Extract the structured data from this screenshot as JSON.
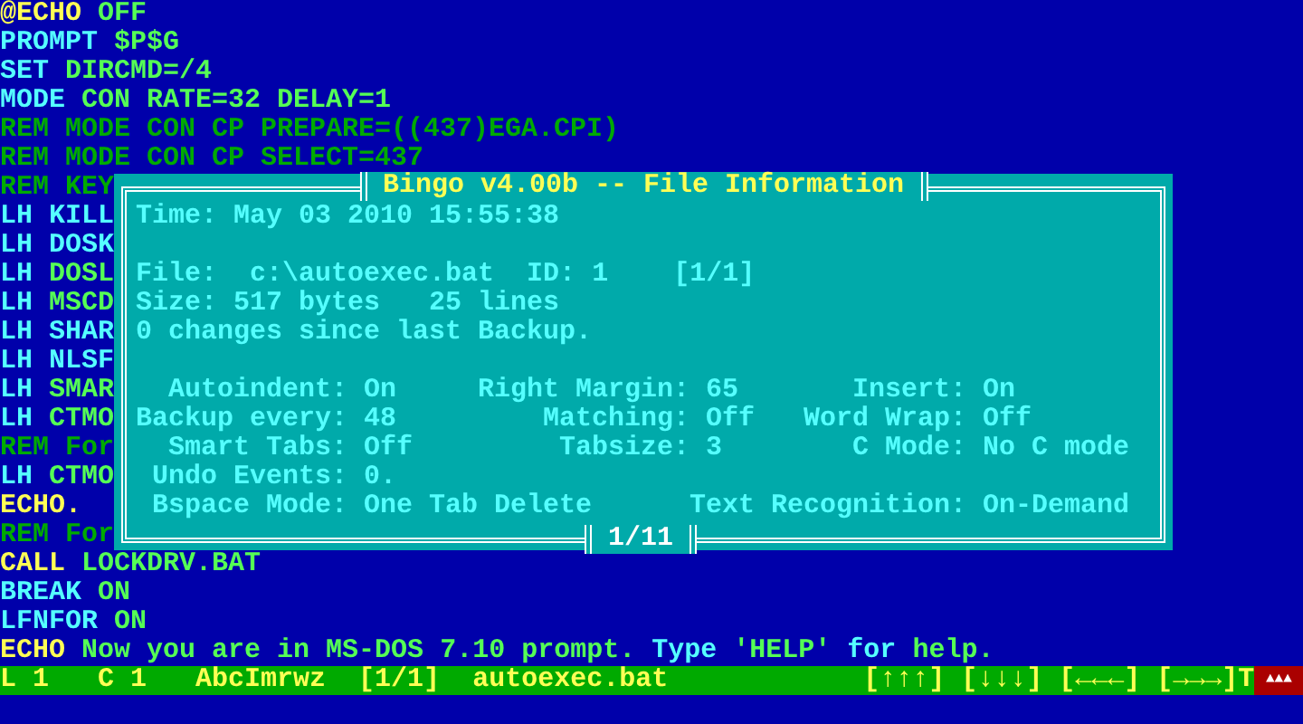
{
  "editor": {
    "lines": [
      [
        {
          "text": "@ECHO",
          "kind": "echo"
        },
        {
          "text": "OFF",
          "kind": "argument"
        }
      ],
      [
        {
          "text": "PROMPT",
          "kind": "command"
        },
        {
          "text": "$P$G",
          "kind": "argument"
        }
      ],
      [
        {
          "text": "SET",
          "kind": "command"
        },
        {
          "text": "DIRCMD=/4",
          "kind": "argument"
        }
      ],
      [
        {
          "text": "MODE",
          "kind": "command"
        },
        {
          "text": "CON RATE=32 DELAY=1",
          "kind": "argument"
        }
      ],
      [
        {
          "text": "REM MODE CON CP PREPARE=((437)EGA.CPI)",
          "kind": "comment"
        }
      ],
      [
        {
          "text": "REM MODE CON CP SELECT=437",
          "kind": "comment"
        }
      ],
      [
        {
          "text": "REM KEY",
          "kind": "comment"
        }
      ],
      [
        {
          "text": "LH",
          "kind": "command"
        },
        {
          "text": "KILL",
          "kind": "command"
        }
      ],
      [
        {
          "text": "LH",
          "kind": "command"
        },
        {
          "text": "DOSK",
          "kind": "command"
        }
      ],
      [
        {
          "text": "LH",
          "kind": "command"
        },
        {
          "text": "DOSL",
          "kind": "argument"
        }
      ],
      [
        {
          "text": "LH",
          "kind": "command"
        },
        {
          "text": "MSCD",
          "kind": "argument"
        }
      ],
      [
        {
          "text": "LH",
          "kind": "command"
        },
        {
          "text": "SHAR",
          "kind": "command"
        }
      ],
      [
        {
          "text": "LH",
          "kind": "command"
        },
        {
          "text": "NLSF",
          "kind": "command"
        }
      ],
      [
        {
          "text": "LH",
          "kind": "command"
        },
        {
          "text": "SMAR",
          "kind": "argument"
        }
      ],
      [
        {
          "text": "LH",
          "kind": "command"
        },
        {
          "text": "CTMO",
          "kind": "argument"
        }
      ],
      [
        {
          "text": "REM For",
          "kind": "comment"
        }
      ],
      [
        {
          "text": "LH",
          "kind": "command"
        },
        {
          "text": "CTMO",
          "kind": "argument"
        }
      ],
      [
        {
          "text": "ECHO.",
          "kind": "echo"
        }
      ],
      [
        {
          "text": "REM For",
          "kind": "comment"
        }
      ],
      [
        {
          "text": "CALL",
          "kind": "echo"
        },
        {
          "text": "LOCKDRV.BAT",
          "kind": "argument"
        }
      ],
      [
        {
          "text": "BREAK",
          "kind": "command"
        },
        {
          "text": "ON",
          "kind": "argument"
        }
      ],
      [
        {
          "text": "LFNFOR",
          "kind": "command"
        },
        {
          "text": "ON",
          "kind": "argument"
        }
      ],
      [
        {
          "text": "ECHO",
          "kind": "echo"
        },
        {
          "text": "Now you are in MS-DOS 7.10 prompt.",
          "kind": "argument"
        },
        {
          "text": "Type",
          "kind": "command"
        },
        {
          "text": "'HELP'",
          "kind": "argument"
        },
        {
          "text": "for",
          "kind": "command"
        },
        {
          "text": "help.",
          "kind": "argument"
        }
      ]
    ]
  },
  "dialog": {
    "title": "Bingo v4.00b -- File Information",
    "time": "Time: May 03 2010 15:55:38",
    "file_label": "File:",
    "file_path": "c:\\autoexec.bat",
    "id_label": "ID:",
    "id": "1",
    "position": "[1/1]",
    "size": "Size: 517 bytes",
    "lines": "25 lines",
    "changes": "0 changes since last Backup.",
    "settings": [
      [
        {
          "label": "Autoindent:",
          "value": "On"
        },
        {
          "label": "Right Margin:",
          "value": "65"
        },
        {
          "label": "Insert:",
          "value": "On"
        }
      ],
      [
        {
          "label": "Backup every:",
          "value": "48"
        },
        {
          "label": "Matching:",
          "value": "Off"
        },
        {
          "label": "Word Wrap:",
          "value": "Off"
        }
      ],
      [
        {
          "label": "Smart Tabs:",
          "value": "Off"
        },
        {
          "label": "Tabsize:",
          "value": "3"
        },
        {
          "label": "C Mode:",
          "value": "No C mode"
        }
      ]
    ],
    "undo": {
      "label": "Undo Events:",
      "value": "0."
    },
    "bspace": {
      "label": "Bspace Mode:",
      "value": "One Tab Delete"
    },
    "recognition": {
      "label": "Text Recognition:",
      "value": "On-Demand"
    },
    "page": "1/11"
  },
  "status_bar": {
    "line": "L 1",
    "column": "C 1",
    "flags": "AbcImrwz",
    "window": "[1/1]",
    "file": "autoexec.bat",
    "indicators": [
      "[↑↑↑]",
      "[↓↓↓]",
      "[←←←]",
      "[→→→]T"
    ],
    "alert": "▲▲▲"
  }
}
